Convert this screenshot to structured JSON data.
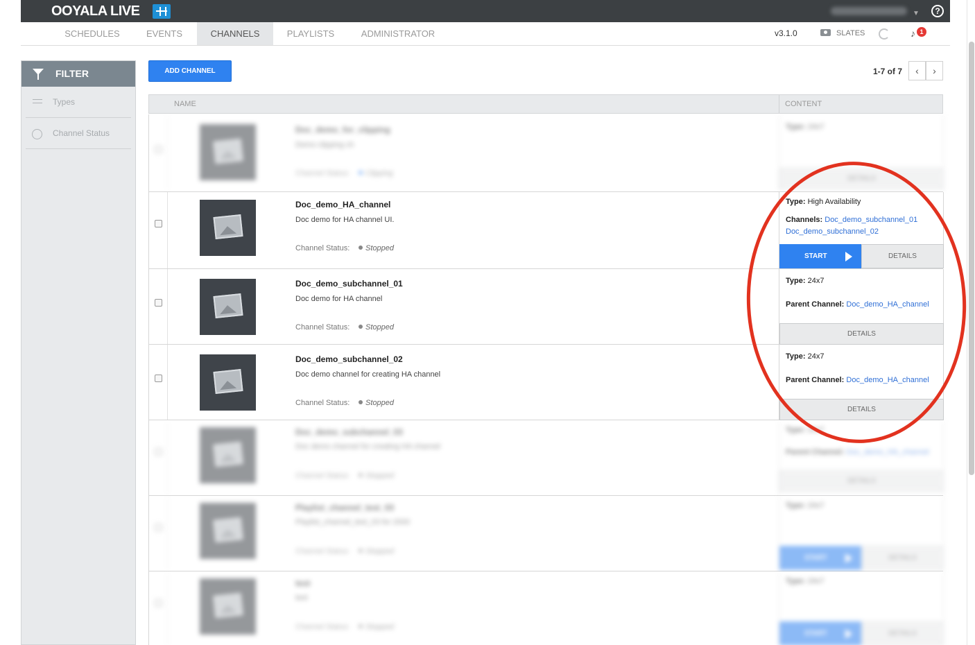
{
  "app": {
    "logo_text": "OOYALA LIVE",
    "user_email": "(blurred)",
    "help_glyph": "?"
  },
  "nav": {
    "tabs": [
      {
        "label": "SCHEDULES",
        "active": false
      },
      {
        "label": "EVENTS",
        "active": false
      },
      {
        "label": "CHANNELS",
        "active": true
      },
      {
        "label": "PLAYLISTS",
        "active": false
      },
      {
        "label": "ADMINISTRATOR",
        "active": false
      }
    ],
    "version": "v3.1.0",
    "slates_label": "SLATES",
    "notification_count": "1"
  },
  "sidebar": {
    "title": "FILTER",
    "items": [
      {
        "label": "Types",
        "icon": "types-icon"
      },
      {
        "label": "Channel Status",
        "icon": "status-icon"
      }
    ]
  },
  "toolbar": {
    "add_channel_label": "ADD CHANNEL",
    "pager_text": "1-7 of 7",
    "prev_glyph": "‹",
    "next_glyph": "›"
  },
  "table": {
    "col_name": "NAME",
    "col_content": "CONTENT",
    "status_label": "Channel Status:",
    "type_label": "Type:",
    "channels_label": "Channels:",
    "parent_label": "Parent Channel:",
    "start_label": "START",
    "details_label": "DETAILS",
    "rows": [
      {
        "name": "Doc_demo_for_clipping",
        "desc": "Demo clipping ch",
        "status": "Clipping",
        "type": "24x7",
        "blurred": true
      },
      {
        "name": "Doc_demo_HA_channel",
        "desc": "Doc demo for HA channel UI.",
        "status": "Stopped",
        "type": "High Availability",
        "channels": [
          "Doc_demo_subchannel_01",
          "Doc_demo_subchannel_02"
        ]
      },
      {
        "name": "Doc_demo_subchannel_01",
        "desc": "Doc demo for HA channel",
        "status": "Stopped",
        "type": "24x7",
        "parent": "Doc_demo_HA_channel"
      },
      {
        "name": "Doc_demo_subchannel_02",
        "desc": "Doc demo channel for creating HA channel",
        "status": "Stopped",
        "type": "24x7",
        "parent": "Doc_demo_HA_channel"
      },
      {
        "name": "Doc_demo_subchannel_03",
        "desc": "Doc demo channel for creating HA channel",
        "status": "Stopped",
        "type": "24x7",
        "parent": "Doc_demo_HA_channel",
        "blurred": true
      },
      {
        "name": "Playlist_channel_test_03",
        "desc": "Playlist_channel_test_03 for 2000",
        "status": "Stopped",
        "type": "24x7",
        "blurred": true
      },
      {
        "name": "test",
        "desc": "test",
        "status": "Stopped",
        "type": "24x7",
        "blurred": true
      }
    ]
  },
  "colors": {
    "topbar": "#3c4043",
    "accent": "#2f82f0",
    "annotation": "#e2321f",
    "link": "#2f6fd6"
  }
}
